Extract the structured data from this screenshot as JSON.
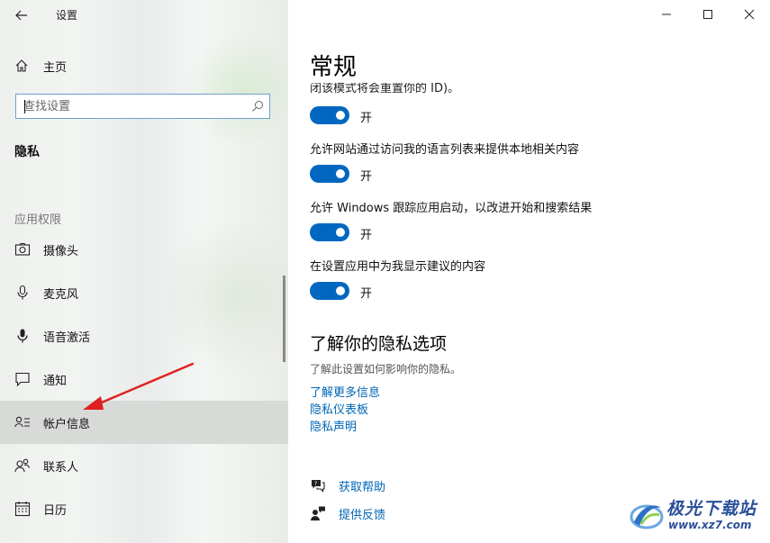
{
  "window": {
    "title": "设置",
    "controls": {
      "minimize_icon": "minimize-icon",
      "maximize_icon": "maximize-icon",
      "close_icon": "close-icon"
    }
  },
  "sidebar": {
    "home_label": "主页",
    "search": {
      "placeholder": "查找设置",
      "value": ""
    },
    "category_title": "隐私",
    "section_header": "应用权限",
    "items": [
      {
        "label": "摄像头",
        "icon": "camera-icon"
      },
      {
        "label": "麦克风",
        "icon": "microphone-icon"
      },
      {
        "label": "语音激活",
        "icon": "voice-activation-icon"
      },
      {
        "label": "通知",
        "icon": "notification-icon"
      },
      {
        "label": "帐户信息",
        "icon": "account-info-icon",
        "selected": true
      },
      {
        "label": "联系人",
        "icon": "contacts-icon"
      },
      {
        "label": "日历",
        "icon": "calendar-icon"
      }
    ]
  },
  "main": {
    "title": "常规",
    "clipped_text": "闭该模式将会重置你的 ID)。",
    "settings": [
      {
        "label": "",
        "state_label": "开",
        "on": true
      },
      {
        "label": "允许网站通过访问我的语言列表来提供本地相关内容",
        "state_label": "开",
        "on": true
      },
      {
        "label": "允许 Windows 跟踪应用启动，以改进开始和搜索结果",
        "state_label": "开",
        "on": true
      },
      {
        "label": "在设置应用中为我显示建议的内容",
        "state_label": "开",
        "on": true
      }
    ],
    "privacy_section": {
      "title": "了解你的隐私选项",
      "description": "了解此设置如何影响你的隐私。",
      "links": [
        "了解更多信息",
        "隐私仪表板",
        "隐私声明"
      ]
    },
    "help": [
      {
        "label": "获取帮助",
        "icon": "get-help-icon"
      },
      {
        "label": "提供反馈",
        "icon": "feedback-icon"
      }
    ]
  },
  "colors": {
    "accent": "#0067c0",
    "link": "#0066b4",
    "annotation_arrow": "#e02020"
  },
  "watermark": {
    "name": "极光下载站",
    "url": "www.xz7.com"
  }
}
